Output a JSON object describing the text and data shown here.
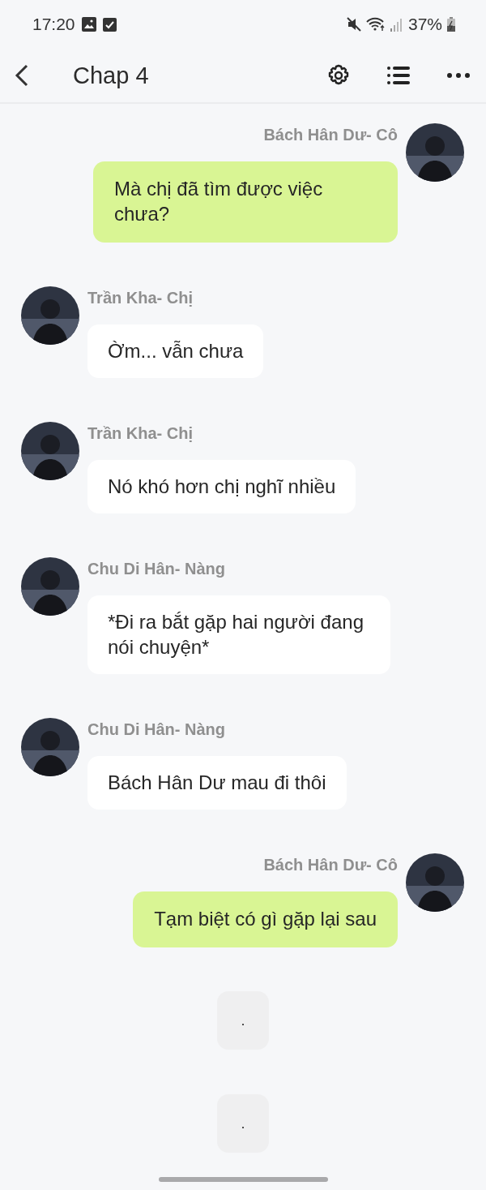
{
  "status_bar": {
    "time": "17:20",
    "battery": "37%"
  },
  "header": {
    "title": "Chap 4"
  },
  "messages": [
    {
      "kind": "sent",
      "sender": "Bách Hân Dư- Cô",
      "text": "Mà chị đã tìm được việc chưa?"
    },
    {
      "kind": "received",
      "sender": "Trần Kha- Chị",
      "text": "Ờm... vẫn chưa"
    },
    {
      "kind": "received",
      "sender": "Trần Kha- Chị",
      "text": "Nó khó hơn chị nghĩ nhiều"
    },
    {
      "kind": "received",
      "sender": "Chu Di Hân- Nàng",
      "text": "*Đi ra bắt gặp hai người đang nói chuyện*"
    },
    {
      "kind": "received",
      "sender": "Chu Di Hân- Nàng",
      "text": "Bách Hân Dư mau đi thôi"
    },
    {
      "kind": "sent",
      "sender": "Bách Hân Dư- Cô",
      "text": "Tạm biệt có gì gặp lại sau"
    },
    {
      "kind": "note",
      "text": "."
    },
    {
      "kind": "note",
      "text": "."
    }
  ]
}
